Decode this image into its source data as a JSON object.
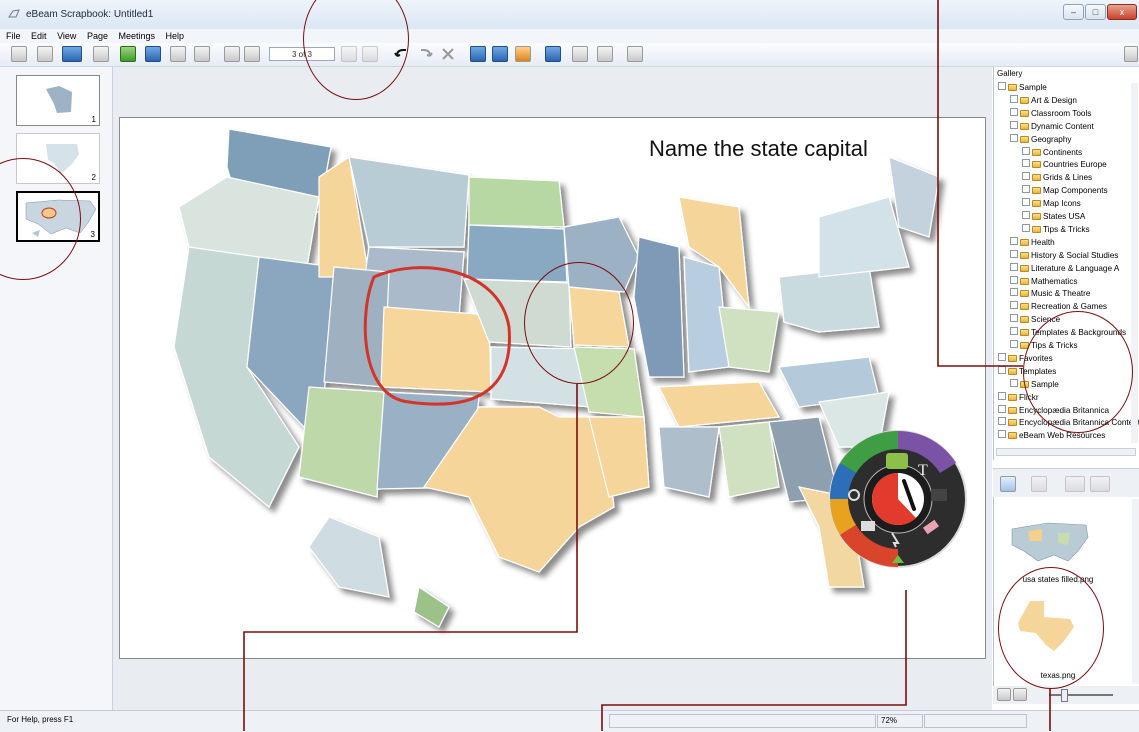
{
  "window": {
    "title": "eBeam Scrapbook: Untitled1"
  },
  "menu": [
    "File",
    "Edit",
    "View",
    "Page",
    "Meetings",
    "Help"
  ],
  "toolbar": {
    "page_indicator": "3 of 3"
  },
  "thumbnails": [
    {
      "number": "1"
    },
    {
      "number": "2"
    },
    {
      "number": "3"
    }
  ],
  "page": {
    "heading": "Name the state capital"
  },
  "gallery": {
    "label": "Gallery",
    "tree": [
      {
        "label": "Sample",
        "level": 0
      },
      {
        "label": "Art & Design",
        "level": 1
      },
      {
        "label": "Classroom Tools",
        "level": 1
      },
      {
        "label": "Dynamic Content",
        "level": 1
      },
      {
        "label": "Geography",
        "level": 1
      },
      {
        "label": "Continents",
        "level": 2
      },
      {
        "label": "Countries Europe",
        "level": 2
      },
      {
        "label": "Grids & Lines",
        "level": 2
      },
      {
        "label": "Map Components",
        "level": 2
      },
      {
        "label": "Map Icons",
        "level": 2
      },
      {
        "label": "States USA",
        "level": 2
      },
      {
        "label": "Tips & Tricks",
        "level": 2
      },
      {
        "label": "Health",
        "level": 1
      },
      {
        "label": "History & Social Studies",
        "level": 1
      },
      {
        "label": "Literature & Language A",
        "level": 1
      },
      {
        "label": "Mathematics",
        "level": 1
      },
      {
        "label": "Music & Theatre",
        "level": 1
      },
      {
        "label": "Recreation & Games",
        "level": 1
      },
      {
        "label": "Science",
        "level": 1
      },
      {
        "label": "Templates & Backgrounds",
        "level": 1
      },
      {
        "label": "Tips & Tricks",
        "level": 1
      },
      {
        "label": "Favorites",
        "level": 0
      },
      {
        "label": "Templates",
        "level": 0
      },
      {
        "label": "Sample",
        "level": 1
      },
      {
        "label": "Flickr",
        "level": 0
      },
      {
        "label": "Encyclopædia Britannica",
        "level": 0
      },
      {
        "label": "Encyclopædia Britannica Content",
        "level": 0
      },
      {
        "label": "eBeam Web Resources",
        "level": 0
      }
    ]
  },
  "resources": {
    "items": [
      {
        "label": "usa states filled.png"
      },
      {
        "label": "texas.png"
      }
    ]
  },
  "status": {
    "help": "For Help, press F1",
    "zoom": "72%"
  },
  "colors": {
    "annotation": "#7a0e0e",
    "accent_yellow": "#f7d79b",
    "accent_blue": "#8fa9c2"
  }
}
